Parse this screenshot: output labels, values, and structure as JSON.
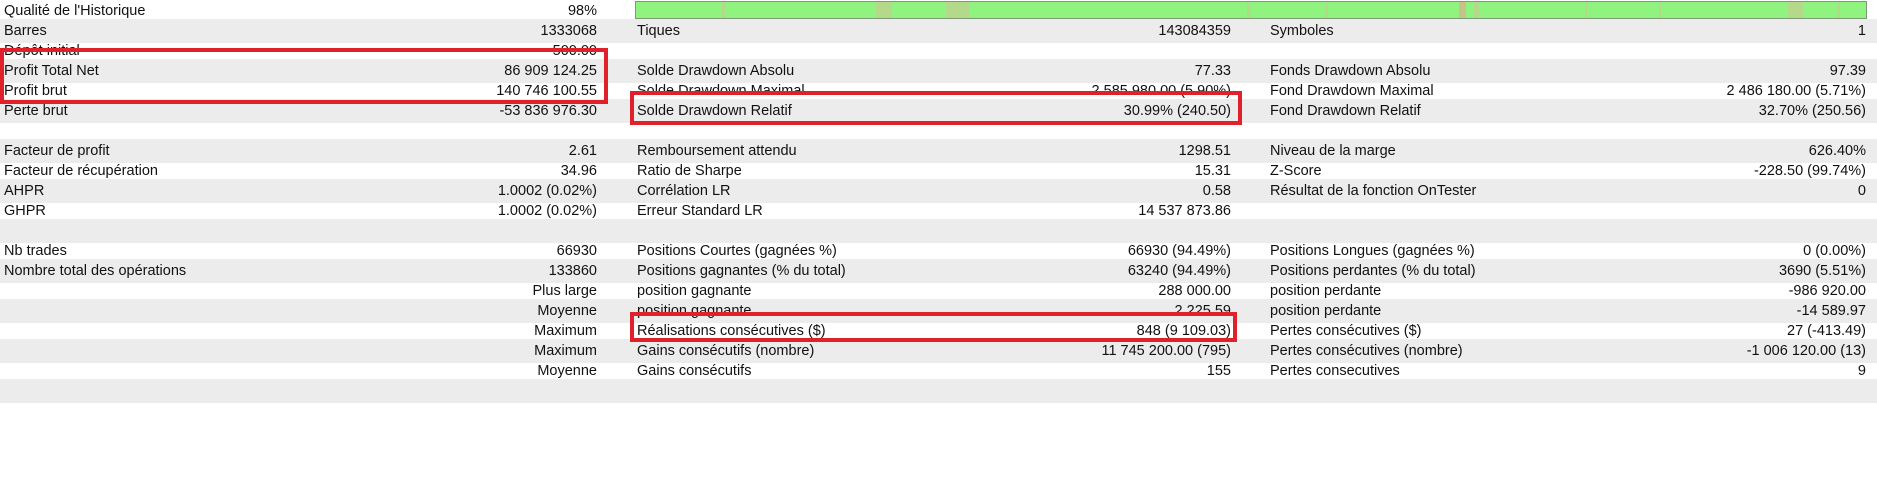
{
  "colors": {
    "highlight": "#e0202a",
    "row_shade": "#ececec",
    "quality_good": "#90f27f",
    "quality_mid": "#b5d98a",
    "quality_low": "#c9c08a"
  },
  "quality": {
    "label": "Qualité de l'Historique",
    "value": "98%",
    "fraction": 0.98
  },
  "rows": {
    "r1": {
      "c1l": "Barres",
      "c1v": "1333068",
      "c2l": "Tiques",
      "c2v": "143084359",
      "c3l": "Symboles",
      "c3v": "1"
    },
    "r2": {
      "c1l": "Dépôt initial",
      "c1v": "500.00"
    },
    "r3": {
      "c1l": "Profit Total Net",
      "c1v": "86 909 124.25",
      "c2l": "Solde Drawdown Absolu",
      "c2v": "77.33",
      "c3l": "Fonds Drawdown Absolu",
      "c3v": "97.39"
    },
    "r4": {
      "c1l": "Profit brut",
      "c1v": "140 746 100.55",
      "c2l": "Solde Drawdown Maximal",
      "c2v": "2 585 980.00 (5.90%)",
      "c3l": "Fond Drawdown Maximal",
      "c3v": "2 486 180.00 (5.71%)"
    },
    "r5": {
      "c1l": "Perte brut",
      "c1v": "-53 836 976.30",
      "c2l": "Solde Drawdown Relatif",
      "c2v": "30.99% (240.50)",
      "c3l": "Fond Drawdown Relatif",
      "c3v": "32.70% (250.56)"
    },
    "r7": {
      "c1l": "Facteur de profit",
      "c1v": "2.61",
      "c2l": "Remboursement attendu",
      "c2v": "1298.51",
      "c3l": "Niveau de la marge",
      "c3v": "626.40%"
    },
    "r8": {
      "c1l": "Facteur de récupération",
      "c1v": "34.96",
      "c2l": "Ratio de Sharpe",
      "c2v": "15.31",
      "c3l": "Z-Score",
      "c3v": "-228.50 (99.74%)"
    },
    "r9": {
      "c1l": "AHPR",
      "c1v": "1.0002 (0.02%)",
      "c2l": "Corrélation LR",
      "c2v": "0.58",
      "c3l": "Résultat de la fonction OnTester",
      "c3v": "0"
    },
    "r10": {
      "c1l": "GHPR",
      "c1v": "1.0002 (0.02%)",
      "c2l": "Erreur Standard LR",
      "c2v": "14 537 873.86"
    },
    "r12": {
      "c1l": "Nb trades",
      "c1v": "66930",
      "c2l": "Positions Courtes (gagnées %)",
      "c2v": "66930 (94.49%)",
      "c3l": "Positions Longues (gagnées %)",
      "c3v": "0 (0.00%)"
    },
    "r13": {
      "c1l": "Nombre total des opérations",
      "c1v": "133860",
      "c2l": "Positions gagnantes (% du total)",
      "c2v": "63240 (94.49%)",
      "c3l": "Positions perdantes (% du total)",
      "c3v": "3690 (5.51%)"
    },
    "r14": {
      "c1v": "Plus large",
      "c2l": "position gagnante",
      "c2v": "288 000.00",
      "c3l": "position perdante",
      "c3v": "-986 920.00"
    },
    "r15": {
      "c1v": "Moyenne",
      "c2l": "position gagnante",
      "c2v": "2 225.59",
      "c3l": "position perdante",
      "c3v": "-14 589.97"
    },
    "r16": {
      "c1v": "Maximum",
      "c2l": "Réalisations consécutives ($)",
      "c2v": "848 (9 109.03)",
      "c3l": "Pertes consécutives ($)",
      "c3v": "27 (-413.49)"
    },
    "r17": {
      "c1v": "Maximum",
      "c2l": "Gains consécutifs (nombre)",
      "c2v": "11 745 200.00 (795)",
      "c3l": "Pertes consécutives (nombre)",
      "c3v": "-1 006 120.00 (13)"
    },
    "r18": {
      "c1v": "Moyenne",
      "c2l": "Gains consécutifs",
      "c2v": "155",
      "c3l": "Pertes consecutives",
      "c3v": "9"
    }
  }
}
